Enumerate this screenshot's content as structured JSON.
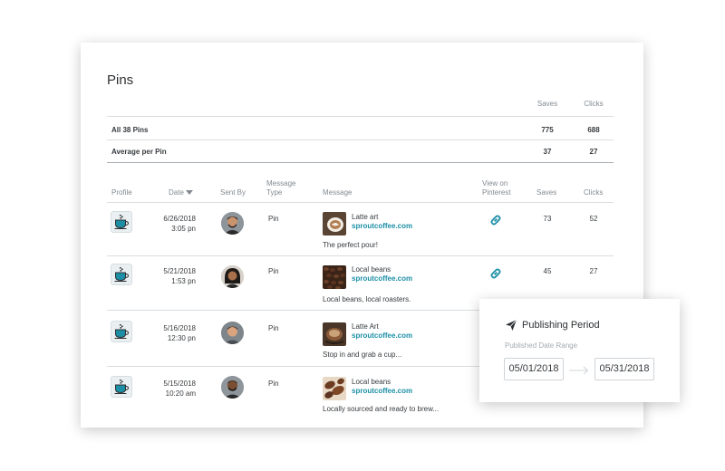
{
  "panel": {
    "title": "Pins"
  },
  "summary": {
    "headers": {
      "saves": "Saves",
      "clicks": "Clicks"
    },
    "rows": [
      {
        "label": "All 38 Pins",
        "saves": "775",
        "clicks": "688"
      },
      {
        "label": "Average per Pin",
        "saves": "37",
        "clicks": "27"
      }
    ]
  },
  "table": {
    "headers": {
      "profile": "Profile",
      "date": "Date",
      "sent_by": "Sent By",
      "message_type_line1": "Message",
      "message_type_line2": "Type",
      "message": "Message",
      "view_line1": "View on",
      "view_line2": "Pinterest",
      "saves": "Saves",
      "clicks": "Clicks"
    },
    "rows": [
      {
        "date": "6/26/2018",
        "time": "3:05 pn",
        "type": "Pin",
        "title": "Latte art",
        "link": "sproutcoffee.com",
        "body": "The perfect pour!",
        "saves": "73",
        "clicks": "52"
      },
      {
        "date": "5/21/2018",
        "time": "1:53 pn",
        "type": "Pin",
        "title": "Local beans",
        "link": "sproutcoffee.com",
        "body": "Local beans, local roasters.",
        "saves": "45",
        "clicks": "27"
      },
      {
        "date": "5/16/2018",
        "time": "12:30 pn",
        "type": "Pin",
        "title": "Latte Art",
        "link": "sproutcoffee.com",
        "body": "Stop in and grab a cup...",
        "saves": "",
        "clicks": ""
      },
      {
        "date": "5/15/2018",
        "time": "10:20 am",
        "type": "Pin",
        "title": "Local beans",
        "link": "sproutcoffee.com",
        "body": "Locally sourced and ready to brew...",
        "saves": "",
        "clicks": ""
      }
    ]
  },
  "popover": {
    "title": "Publishing Period",
    "subtitle": "Published Date Range",
    "start": "05/01/2018",
    "end": "05/31/2018"
  },
  "colors": {
    "link": "#1c8fa6",
    "icon_teal": "#1c8fa6"
  }
}
